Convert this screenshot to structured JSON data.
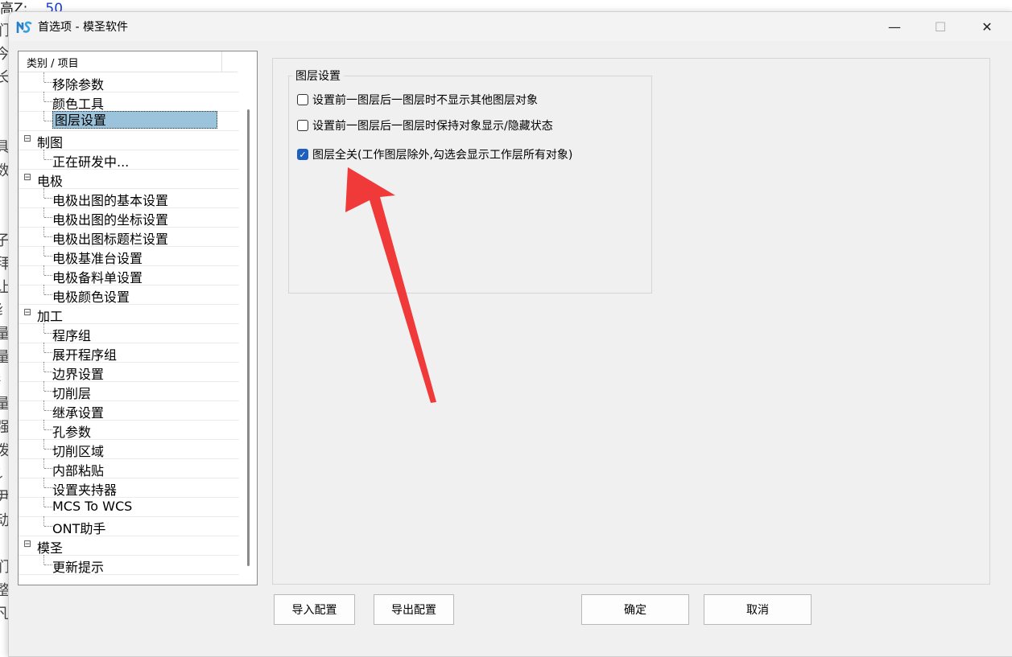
{
  "background": {
    "top_label": "高Z:",
    "top_value": "50",
    "strip_chars": [
      "们",
      "今",
      "长",
      "",
      "",
      "具",
      "数",
      "",
      "",
      "子",
      "拜",
      "让",
      "纟",
      "量",
      "量",
      "冫",
      "量",
      "强",
      "泼",
      "讠",
      "尹",
      "动",
      "",
      "们",
      "整",
      "凡"
    ]
  },
  "window": {
    "title": "首选项 - 模圣软件",
    "min_symbol": "—",
    "max_symbol": "☐",
    "close_symbol": "✕"
  },
  "tree": {
    "header": "类别 / 项目",
    "rows": [
      {
        "label": "移除参数",
        "level": 1
      },
      {
        "label": "颜色工具",
        "level": 1
      },
      {
        "label": "图层设置",
        "level": 1,
        "selected": true
      },
      {
        "label": "制图",
        "level": 0
      },
      {
        "label": "正在研发中...",
        "level": 1
      },
      {
        "label": "电极",
        "level": 0
      },
      {
        "label": "电极出图的基本设置",
        "level": 1
      },
      {
        "label": "电极出图的坐标设置",
        "level": 1
      },
      {
        "label": "电极出图标题栏设置",
        "level": 1
      },
      {
        "label": "电极基准台设置",
        "level": 1
      },
      {
        "label": "电极备料单设置",
        "level": 1
      },
      {
        "label": "电极颜色设置",
        "level": 1
      },
      {
        "label": "加工",
        "level": 0
      },
      {
        "label": "程序组",
        "level": 1
      },
      {
        "label": "展开程序组",
        "level": 1
      },
      {
        "label": "边界设置",
        "level": 1
      },
      {
        "label": "切削层",
        "level": 1
      },
      {
        "label": "继承设置",
        "level": 1
      },
      {
        "label": "孔参数",
        "level": 1
      },
      {
        "label": "切削区域",
        "level": 1
      },
      {
        "label": "内部粘贴",
        "level": 1
      },
      {
        "label": "设置夹持器",
        "level": 1
      },
      {
        "label": "MCS To WCS",
        "level": 1
      },
      {
        "label": "ONT助手",
        "level": 1
      },
      {
        "label": "模圣",
        "level": 0
      },
      {
        "label": "更新提示",
        "level": 1
      }
    ]
  },
  "group": {
    "title": "图层设置",
    "options": [
      {
        "label": "设置前一图层后一图层时不显示其他图层对象",
        "checked": false
      },
      {
        "label": "设置前一图层后一图层时保持对象显示/隐藏状态",
        "checked": false
      },
      {
        "label": "图层全关(工作图层除外,勾选会显示工作层所有对象)",
        "checked": true
      }
    ]
  },
  "buttons": {
    "import": "导入配置",
    "export": "导出配置",
    "ok": "确定",
    "cancel": "取消"
  },
  "colors": {
    "selection": "#9bc4dc",
    "checkbox_on": "#1f5fbf",
    "arrow": "#f03a3a"
  }
}
